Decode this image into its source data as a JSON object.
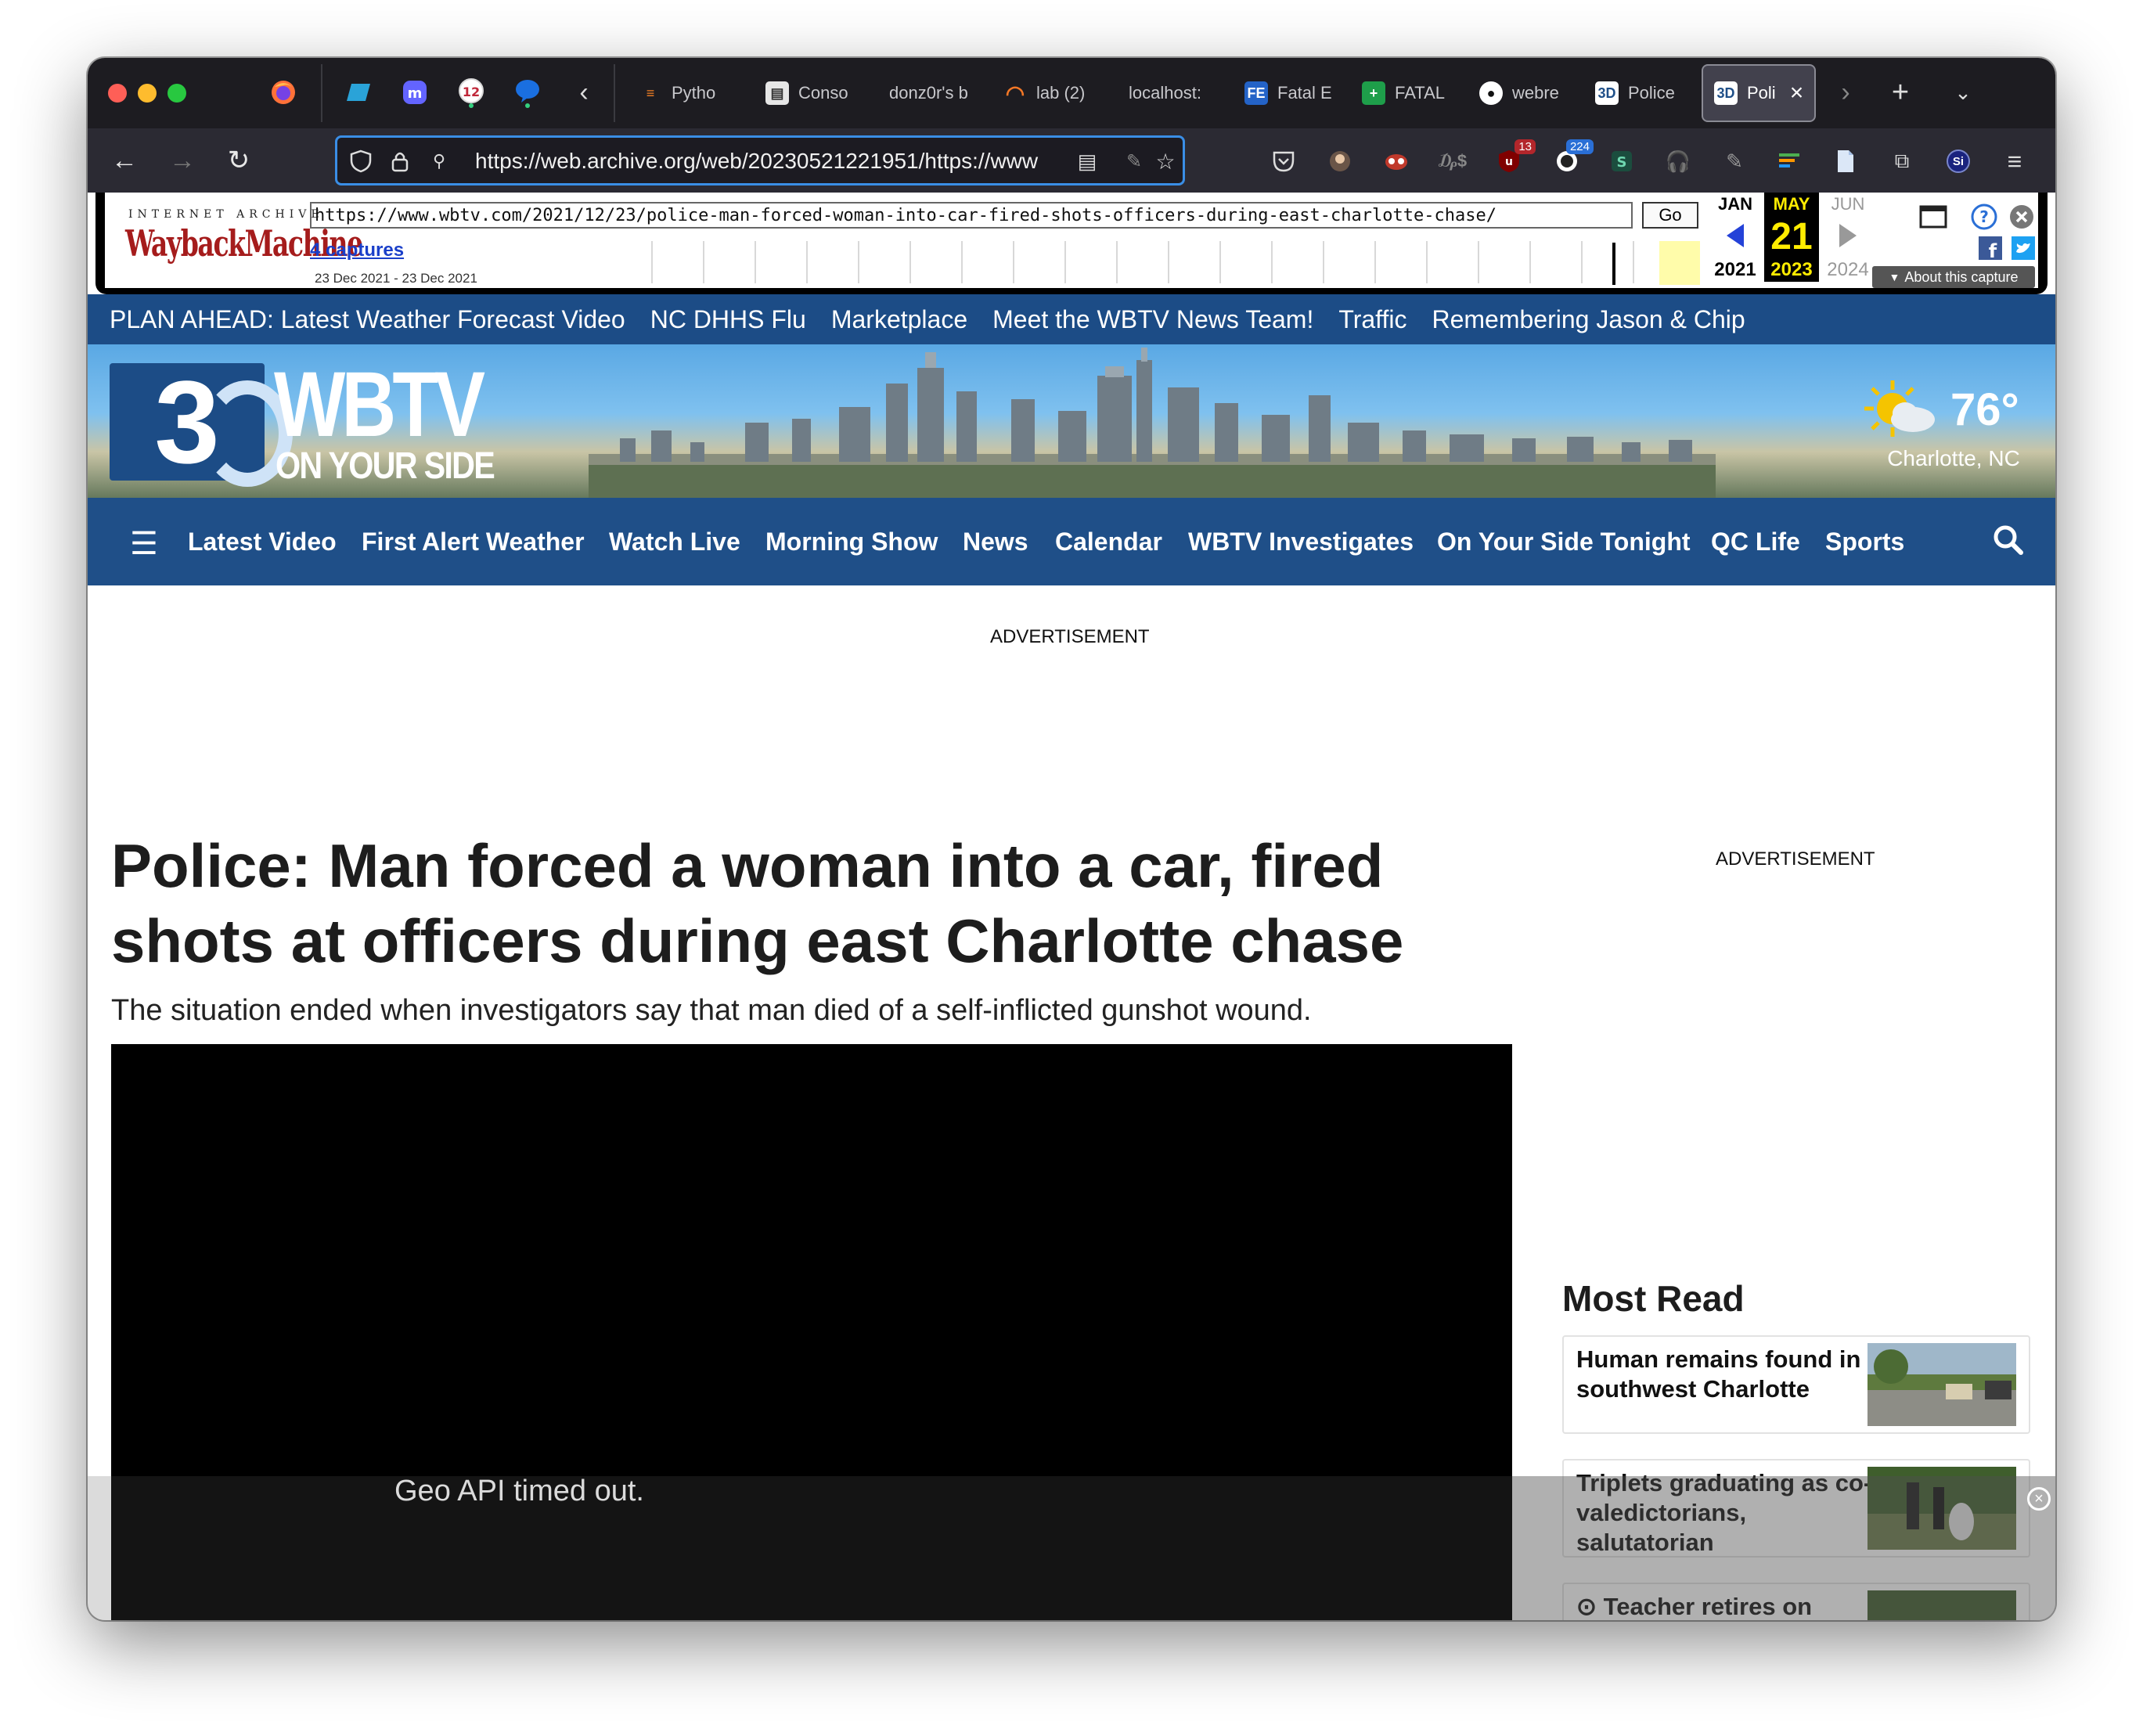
{
  "browser": {
    "tabs": [
      {
        "label": "Pytho",
        "icon": "stack-overflow-icon",
        "color": "#f48024"
      },
      {
        "label": "Conso",
        "icon": "console-icon",
        "color": "#888888"
      },
      {
        "label": "donz0r's b",
        "icon": "",
        "color": ""
      },
      {
        "label": "lab (2)",
        "icon": "jupyter-icon",
        "color": "#f37726"
      },
      {
        "label": "localhost:",
        "icon": "",
        "color": ""
      },
      {
        "label": "Fatal E",
        "icon": "fe-icon",
        "color": "#2463c7"
      },
      {
        "label": "FATAL",
        "icon": "sheets-icon",
        "color": "#1e9e4a"
      },
      {
        "label": "webre",
        "icon": "github-icon",
        "color": "#ffffff"
      },
      {
        "label": "Police",
        "icon": "wbtv-icon",
        "color": "#ffffff"
      },
      {
        "label": "Poli",
        "icon": "wbtv-icon",
        "color": "#ffffff",
        "active": true
      }
    ],
    "pinned_badge": "12",
    "url": "https://web.archive.org/web/20230521221951/https://www",
    "ext_badges": {
      "red": "13",
      "blue": "224"
    },
    "profile": "Si"
  },
  "wayback": {
    "brand_top": "INTERNET ARCHIVE",
    "brand": "WaybackMachine",
    "url": "https://www.wbtv.com/2021/12/23/police-man-forced-woman-into-car-fired-shots-officers-during-east-charlotte-chase/",
    "go": "Go",
    "captures": "4 captures",
    "range": "23 Dec 2021 - 23 Dec 2021",
    "prev": {
      "month": "JAN",
      "year": "2021"
    },
    "current": {
      "month": "MAY",
      "day": "21",
      "year": "2023"
    },
    "next": {
      "month": "JUN",
      "year": "2024"
    },
    "about": "About this capture"
  },
  "site": {
    "promo_links": [
      "PLAN AHEAD: Latest Weather Forecast Video",
      "NC DHHS Flu",
      "Marketplace",
      "Meet the WBTV News Team!",
      "Traffic",
      "Remembering Jason & Chip"
    ],
    "logo_number": "3",
    "logo_text": "WBTV",
    "logo_tagline": "ON YOUR SIDE",
    "weather": {
      "temp": "76°",
      "city": "Charlotte, NC"
    },
    "nav": [
      "Latest Video",
      "First Alert Weather",
      "Watch Live",
      "Morning Show",
      "News",
      "Calendar",
      "WBTV Investigates",
      "On Your Side Tonight",
      "QC Life",
      "Sports"
    ],
    "ad_label": "ADVERTISEMENT"
  },
  "article": {
    "headline": "Police: Man forced a woman into a car, fired shots at officers during east Charlotte chase",
    "subhead": "The situation ended when investigators say that man died of a self-inflicted gunshot wound.",
    "video_message": "Geo API timed out."
  },
  "sidebar": {
    "ad_label": "ADVERTISEMENT",
    "most_read_title": "Most Read",
    "items": [
      {
        "title": "Human remains found in southwest Charlotte"
      },
      {
        "title": "Triplets graduating as co-valedictorians, salutatorian"
      },
      {
        "title": "Teacher retires on"
      }
    ]
  }
}
